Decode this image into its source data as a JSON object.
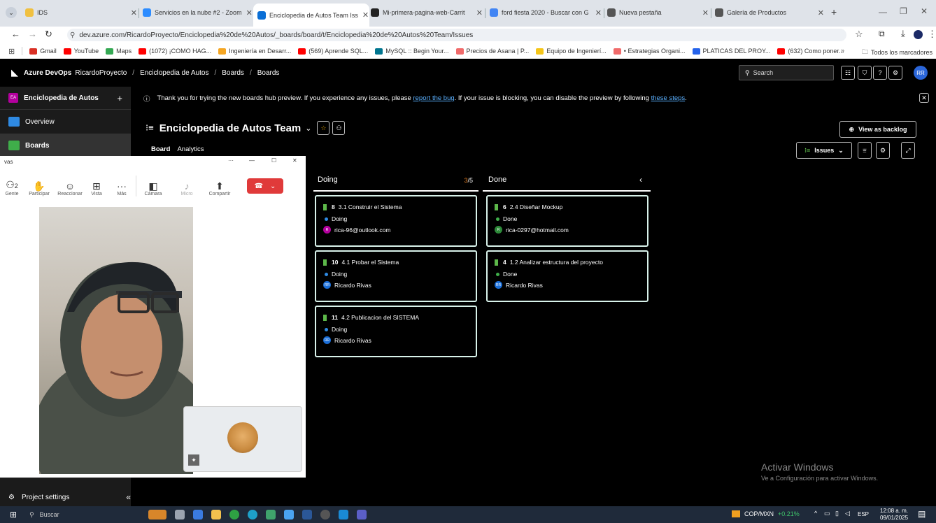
{
  "browser": {
    "tabs": [
      {
        "title": "IDS",
        "color": "#f0c040"
      },
      {
        "title": "Servicios en la nube #2 - Zoom",
        "color": "#2d8cff"
      },
      {
        "title": "Enciclopedia de Autos Team Iss",
        "color": "#0b6fd6"
      },
      {
        "title": "Mi-primera-pagina-web-Carrit",
        "color": "#222222"
      },
      {
        "title": "ford fiesta 2020 - Buscar con G",
        "color": "#4285f4"
      },
      {
        "title": "Nueva pestaña",
        "color": "#555555"
      },
      {
        "title": "Galería de Productos",
        "color": "#555555"
      }
    ],
    "url": "dev.azure.com/RicardoProyecto/Enciclopedia%20de%20Autos/_boards/board/t/Enciclopedia%20de%20Autos%20Team/Issues",
    "bookmarks": [
      {
        "label": "Gmail",
        "color": "#d93025"
      },
      {
        "label": "YouTube",
        "color": "#ff0000"
      },
      {
        "label": "Maps",
        "color": "#34a853"
      },
      {
        "label": "(1072) ¡COMO HAG...",
        "color": "#ff0000"
      },
      {
        "label": "Ingeniería en Desarr...",
        "color": "#f5a623"
      },
      {
        "label": "(569) Aprende SQL...",
        "color": "#ff0000"
      },
      {
        "label": "MySQL :: Begin Your...",
        "color": "#00758f"
      },
      {
        "label": "Precios de Asana | P...",
        "color": "#f06a6a"
      },
      {
        "label": "Equipo de Ingenierí...",
        "color": "#f5c518"
      },
      {
        "label": "• Estrategias Organi...",
        "color": "#f06a6a"
      },
      {
        "label": "PLATICAS DEL PROY...",
        "color": "#2563eb"
      },
      {
        "label": "(632) Como poner...",
        "color": "#ff0000"
      }
    ],
    "all_bookmarks": "Todos los marcadores"
  },
  "ado": {
    "brand": "Azure DevOps",
    "org": "RicardoProyecto",
    "crumbs": [
      "Enciclopedia de Autos",
      "Boards",
      "Boards"
    ],
    "search_placeholder": "Search",
    "user_initials": "RR",
    "project_initials": "EA",
    "project_name": "Enciclopedia de Autos",
    "nav": [
      "Overview",
      "Boards"
    ],
    "project_settings": "Project settings",
    "banner": {
      "pre": "Thank you for trying the new boards hub preview. If you experience any issues, please ",
      "link1": "report the bug",
      "mid": ". If your issue is blocking, you can disable the preview by following ",
      "link2": "these steps",
      "post": "."
    },
    "team": "Enciclopedia de Autos Team",
    "view_tabs": [
      "Board",
      "Analytics"
    ],
    "view_as_backlog": "View as backlog",
    "issues_label": "Issues",
    "columns": [
      {
        "name": "Doing",
        "count": "3",
        "limit": "/5"
      },
      {
        "name": "Done"
      }
    ],
    "doing_cards": [
      {
        "id": "8",
        "title": "3.1 Construir el Sistema",
        "state": "Doing",
        "assignee": "rica-96@outlook.com",
        "av": "R",
        "avcolor": "#b4009e"
      },
      {
        "id": "10",
        "title": "4.1 Probar el Sistema",
        "state": "Doing",
        "assignee": "Ricardo Rivas",
        "av": "RR",
        "avcolor": "#1a6ed8"
      },
      {
        "id": "11",
        "title": "4.2 Publicacion del SISTEMA",
        "state": "Doing",
        "assignee": "Ricardo Rivas",
        "av": "RR",
        "avcolor": "#1a6ed8"
      }
    ],
    "done_cards": [
      {
        "id": "6",
        "title": "2.4 Diseñar Mockup",
        "state": "Done",
        "assignee": "rica-0297@hotmail.com",
        "av": "R",
        "avcolor": "#2e8b3a"
      },
      {
        "id": "4",
        "title": "1.2 Analizar estructura del proyecto",
        "state": "Done",
        "assignee": "Ricardo Rivas",
        "av": "RR",
        "avcolor": "#1a6ed8"
      }
    ],
    "colors": {
      "doing": "#2f8ae3",
      "done": "#3fae4a",
      "card_border": "#d8f2ea",
      "book": "#5db84a"
    }
  },
  "zoom": {
    "title": "vas",
    "participants_count": "2",
    "toolbar": [
      "Gente",
      "Participar",
      "Reaccionar",
      "Vista",
      "Más",
      "Cámara",
      "Micro",
      "Compartir"
    ]
  },
  "watermark": {
    "title": "Activar Windows",
    "sub": "Ve a Configuración para activar Windows."
  },
  "taskbar": {
    "search": "Buscar",
    "ticker": "COP/MXN",
    "ticker_change": "+0.21%",
    "lang": "ESP",
    "time": "12:08 a. m.",
    "date": "09/01/2025"
  }
}
